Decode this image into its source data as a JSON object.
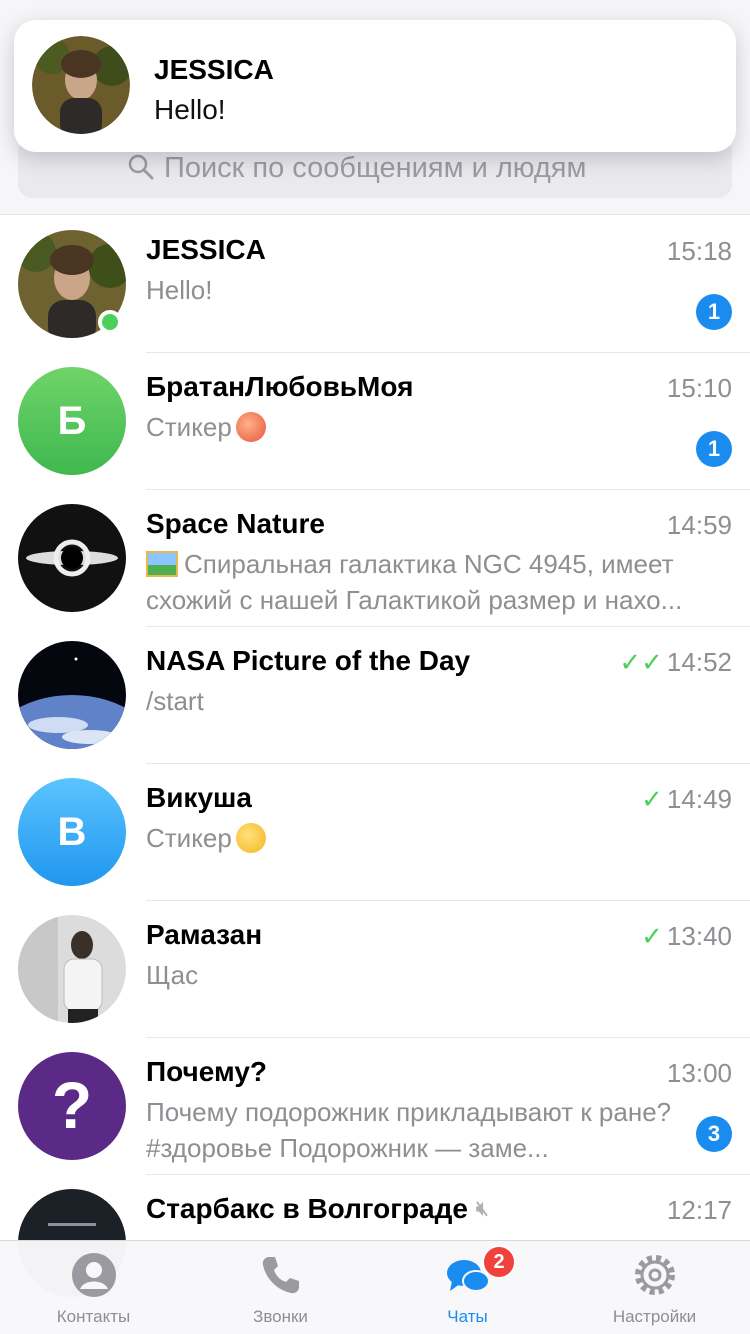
{
  "notification": {
    "title": "JESSICA",
    "text": "Hello!"
  },
  "search": {
    "placeholder": "Поиск по сообщениям и людям"
  },
  "chats": [
    {
      "name": "JESSICA",
      "preview": "Hello!",
      "time": "15:18",
      "badge": "1",
      "online": true,
      "avatar_icon": "photo-avatar"
    },
    {
      "name": "БратанЛюбовьМоя",
      "preview": "Стикер",
      "time": "15:10",
      "badge": "1",
      "avatar_letter": "Б",
      "avatar_color": "#4cc25b",
      "emoji_icon": "peach-emoji-icon"
    },
    {
      "name": "Space Nature",
      "preview": "Спиральная галактика NGC 4945, имеет схожий с нашей Галактикой размер и нахо...",
      "time": "14:59",
      "avatar_icon": "galaxy-avatar",
      "image_icon": "picture-icon"
    },
    {
      "name": "NASA Picture of the Day",
      "preview": "/start",
      "time": "14:52",
      "read_status": "double-check",
      "avatar_icon": "earth-avatar"
    },
    {
      "name": "Викуша",
      "preview": "Стикер",
      "time": "14:49",
      "read_status": "check",
      "avatar_letter": "В",
      "avatar_color": "#2fa8f5",
      "emoji_icon": "grin-emoji-icon"
    },
    {
      "name": "Рамазан",
      "preview": "Щас",
      "time": "13:40",
      "read_status": "check",
      "avatar_icon": "photo-avatar"
    },
    {
      "name": "Почему?",
      "preview": "Почему подорожник прикладывают к ране? #здоровье  Подорожник — заме...",
      "time": "13:00",
      "badge": "3",
      "avatar_icon": "question-avatar",
      "avatar_color": "#5b2a86"
    },
    {
      "name": "Старбакс в Волгограде",
      "preview": "",
      "time": "12:17",
      "muted": true,
      "avatar_icon": "dark-avatar"
    }
  ],
  "tabs": [
    {
      "label": "Контакты",
      "icon": "contacts-icon"
    },
    {
      "label": "Звонки",
      "icon": "phone-icon"
    },
    {
      "label": "Чаты",
      "icon": "chats-icon",
      "badge": "2",
      "active": true
    },
    {
      "label": "Настройки",
      "icon": "settings-icon"
    }
  ],
  "colors": {
    "accent": "#1a8cf0",
    "online": "#4bd05b",
    "tab_badge": "#f0413c"
  }
}
